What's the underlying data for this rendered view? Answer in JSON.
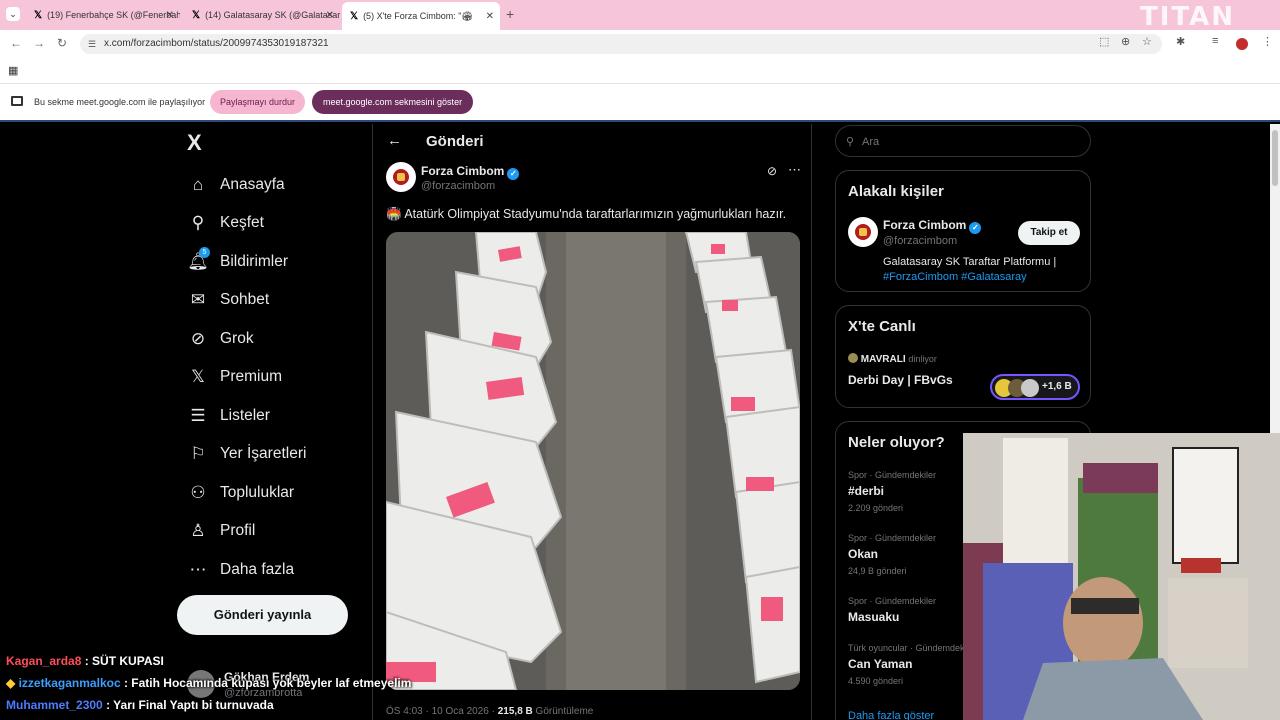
{
  "browser": {
    "tabs": [
      {
        "title": "(19) Fenerbahçe SK (@Fenerbahçe"
      },
      {
        "title": "(14) Galatasaray SK (@Galatasaray"
      },
      {
        "title": "(5) X'te Forza Cimbom: \"🏟"
      }
    ],
    "new_tab": "+",
    "url": "x.com/forzacimbom/status/2009974353019187321",
    "watermark": "TITAN"
  },
  "share_bar": {
    "text": "Bu sekme meet.google.com ile paylaşılıyor",
    "stop_label": "Paylaşmayı durdur",
    "show_label": "meet.google.com sekmesini göster"
  },
  "sidebar": {
    "logo": "X",
    "items": [
      {
        "label": "Anasayfa",
        "icon": "home-icon"
      },
      {
        "label": "Keşfet",
        "icon": "search-icon"
      },
      {
        "label": "Bildirimler",
        "icon": "bell-icon",
        "badge": "5"
      },
      {
        "label": "Sohbet",
        "icon": "mail-icon"
      },
      {
        "label": "Grok",
        "icon": "grok-icon"
      },
      {
        "label": "Premium",
        "icon": "x-icon"
      },
      {
        "label": "Listeler",
        "icon": "list-icon"
      },
      {
        "label": "Yer İşaretleri",
        "icon": "bookmark-icon"
      },
      {
        "label": "Topluluklar",
        "icon": "communities-icon"
      },
      {
        "label": "Profil",
        "icon": "profile-icon"
      },
      {
        "label": "Daha fazla",
        "icon": "more-icon"
      }
    ],
    "post_button": "Gönderi yayınla",
    "account": {
      "name": "Gökhan Erdem",
      "handle": "@zforzambrotta"
    }
  },
  "main": {
    "title": "Gönderi",
    "post": {
      "author": "Forza Cimbom",
      "handle": "@forzacimbom",
      "text": "🏟️ Atatürk Olimpiyat Stadyumu'nda taraftarlarımızın yağmurlukları hazır.",
      "time_label": "ÖS 4:03 · 10 Oca 2026 ·",
      "views": "215,8 B",
      "views_label": "Görüntüleme"
    }
  },
  "right": {
    "search_placeholder": "Ara",
    "relevant": {
      "title": "Alakalı kişiler",
      "name": "Forza Cimbom",
      "handle": "@forzacimbom",
      "follow_label": "Takip et",
      "bio": "Galatasaray SK Taraftar Platformu |",
      "bio_tags": "#ForzaCimbom #Galatasaray"
    },
    "live": {
      "title": "X'te Canlı",
      "host": "MAVRALI",
      "host_status": "dinliyor",
      "space_title": "Derbi Day | FBvGs",
      "listeners": "+1,6 B"
    },
    "trends": {
      "title": "Neler oluyor?",
      "items": [
        {
          "category": "Spor · Gündemdekiler",
          "name": "#derbi",
          "count": "2.209 gönderi"
        },
        {
          "category": "Spor · Gündemdekiler",
          "name": "Okan",
          "count": "24,9 B gönderi"
        },
        {
          "category": "Spor · Gündemdekiler",
          "name": "Masuaku",
          "count": ""
        },
        {
          "category": "Türk oyuncular · Gündemdeki",
          "name": "Can Yaman",
          "count": "4.590 gönderi"
        }
      ],
      "show_more": "Daha fazla göster"
    }
  },
  "chat": [
    {
      "user": "Kagan_arda8",
      "message": ": SÜT KUPASI"
    },
    {
      "user": "izzetkaganmalkoc",
      "message": ": Fatih Hocamında kupası yok beyler laf etmeyelim"
    },
    {
      "user": "Muhammet_2300",
      "message": ": Yarı Final Yaptı bi turnuvada"
    }
  ],
  "colors": {
    "accent": "#1d9bf0",
    "tab_bar": "#f7c5d9",
    "share_stop": "#f7b6d0",
    "share_show": "#6b2d5c"
  }
}
